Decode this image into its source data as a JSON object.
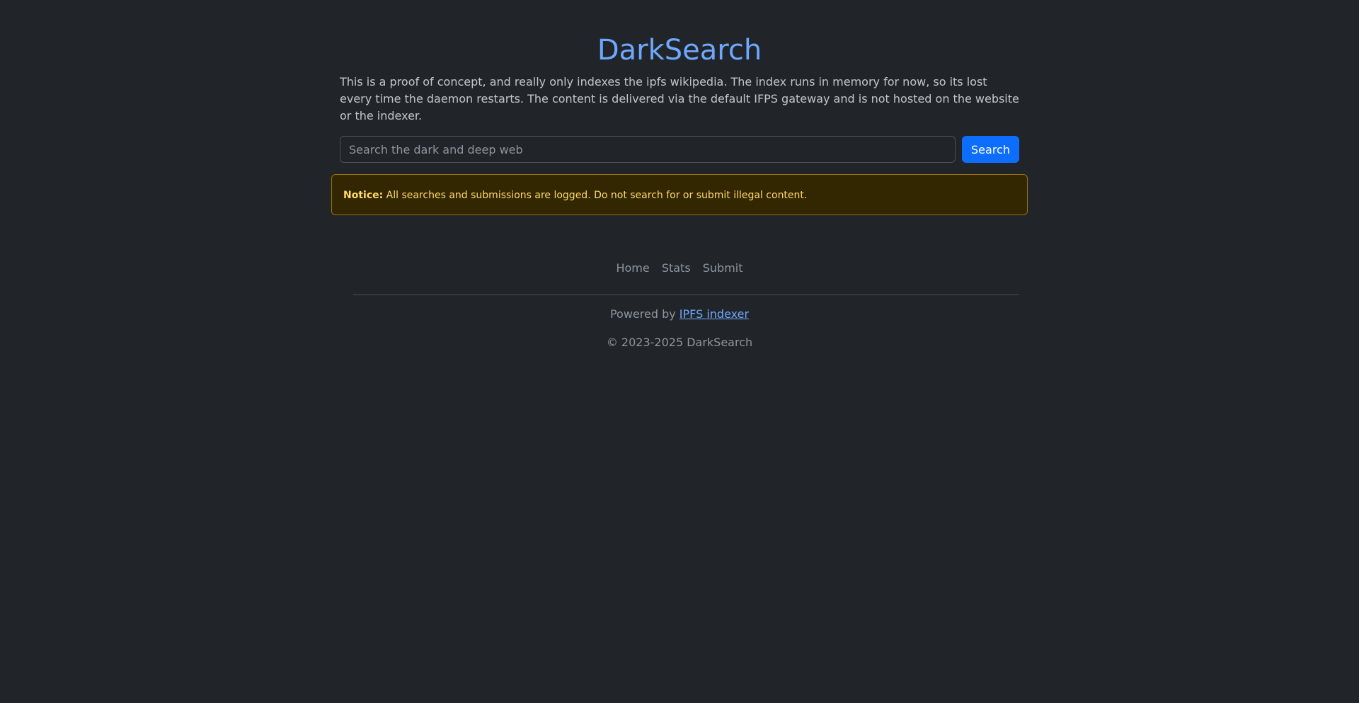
{
  "app": {
    "title": "DarkSearch"
  },
  "intro": {
    "text": "This is a proof of concept, and really only indexes the ipfs wikipedia. The index runs in memory for now, so its lost every time the daemon restarts. The content is delivered via the default IFPS gateway and is not hosted on the website or the indexer."
  },
  "search": {
    "placeholder": "Search the dark and deep web",
    "value": "",
    "button_label": "Search"
  },
  "notice": {
    "label": "Notice:",
    "text": "All searches and submissions are logged. Do not search for or submit illegal content."
  },
  "footer": {
    "nav": [
      {
        "label": "Home"
      },
      {
        "label": "Stats"
      },
      {
        "label": "Submit"
      }
    ],
    "powered_prefix": "Powered by",
    "powered_link": "IPFS indexer",
    "copyright": "© 2023-2025 DarkSearch"
  },
  "colors": {
    "background": "#212529",
    "accent": "#6ea8fe",
    "primary_button": "#0d6efd",
    "notice_bg": "#332701",
    "notice_text": "#ffda6a"
  }
}
